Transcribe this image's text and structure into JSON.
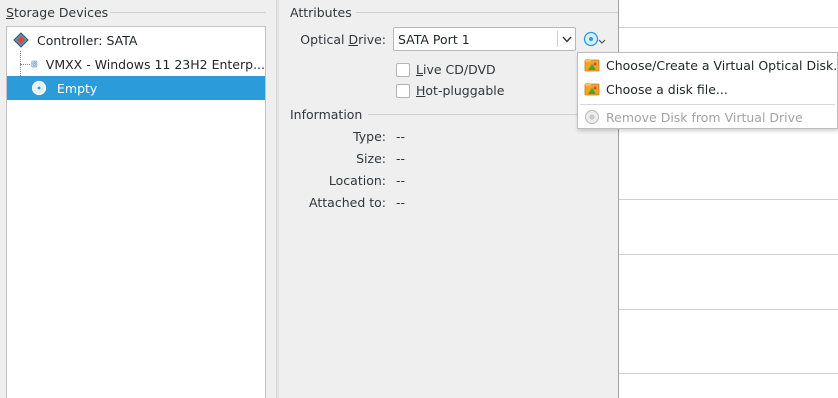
{
  "storage_devices": {
    "title": "Storage Devices",
    "tree": [
      {
        "label": "Controller: SATA",
        "icon": "sata-controller-icon"
      },
      {
        "label": "VMXX - Windows 11 23H2 Enterp...",
        "icon": "hard-disk-icon"
      },
      {
        "label": "Empty",
        "icon": "optical-disc-icon",
        "selected": true
      }
    ]
  },
  "attributes": {
    "title": "Attributes",
    "optical_drive_label": "Optical Drive:",
    "optical_drive_value": "SATA Port 1",
    "live_cd_label": "Live CD/DVD",
    "hot_pluggable_label": "Hot-pluggable"
  },
  "information": {
    "title": "Information",
    "rows": [
      {
        "label": "Type:",
        "value": "--"
      },
      {
        "label": "Size:",
        "value": "--"
      },
      {
        "label": "Location:",
        "value": "--"
      },
      {
        "label": "Attached to:",
        "value": "--"
      }
    ]
  },
  "disc_menu": {
    "items": [
      {
        "label": "Choose/Create a Virtual Optical Disk...",
        "enabled": true
      },
      {
        "label": "Choose a disk file...",
        "enabled": true
      },
      {
        "label": "Remove Disk from Virtual Drive",
        "enabled": false
      }
    ]
  },
  "colors": {
    "selection": "#2c9bd9",
    "disabled_text": "#a3a3a3"
  }
}
